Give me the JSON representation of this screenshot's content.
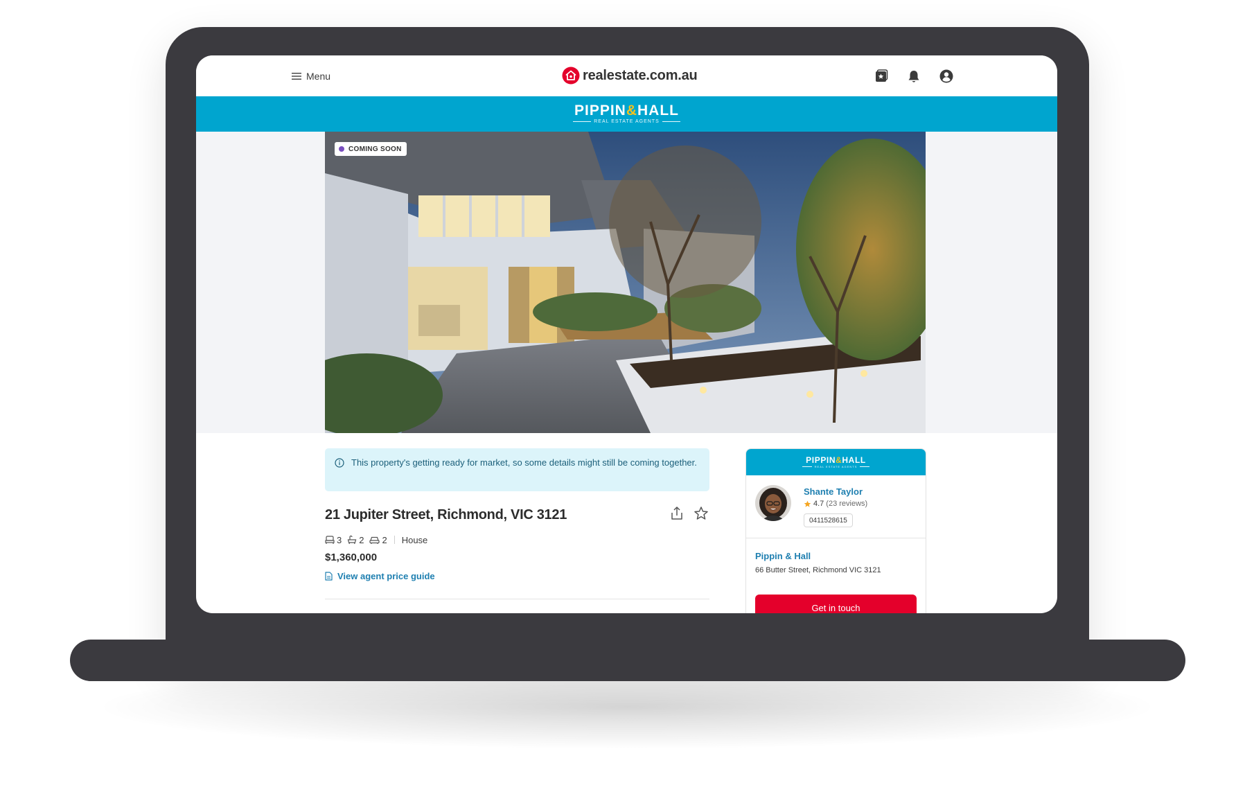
{
  "header": {
    "menu_label": "Menu",
    "logo_text": "realestate.com.au",
    "icons": [
      "saved-searches-icon",
      "notifications-bell-icon",
      "account-icon"
    ]
  },
  "agency_banner": {
    "name_part1": "PIPPIN",
    "name_amp": "&",
    "name_part2": "HALL",
    "tagline": "REAL ESTATE AGENTS"
  },
  "listing": {
    "badge": "COMING SOON",
    "notice": "This property's getting ready for market, so some details might still be coming together.",
    "address": "21 Jupiter Street, Richmond, VIC 3121",
    "features": {
      "bedrooms": "3",
      "bathrooms": "2",
      "car_spaces": "2",
      "property_type": "House"
    },
    "price": "$1,360,000",
    "price_guide_link": "View agent price guide"
  },
  "agent_card": {
    "agent_name": "Shante Taylor",
    "rating": "4.7",
    "reviews": "(23 reviews)",
    "phone": "0411528615",
    "agency_name": "Pippin & Hall",
    "agency_address": "66 Butter Street, Richmond VIC 3121",
    "cta_label": "Get in touch"
  },
  "colors": {
    "brand_red": "#e4002b",
    "agency_blue": "#00a5cf",
    "link_blue": "#1e7fb0",
    "notice_bg": "#dcf4fa",
    "laptop_frame": "#3b3a3f",
    "coming_soon_dot": "#7a4fbf"
  }
}
